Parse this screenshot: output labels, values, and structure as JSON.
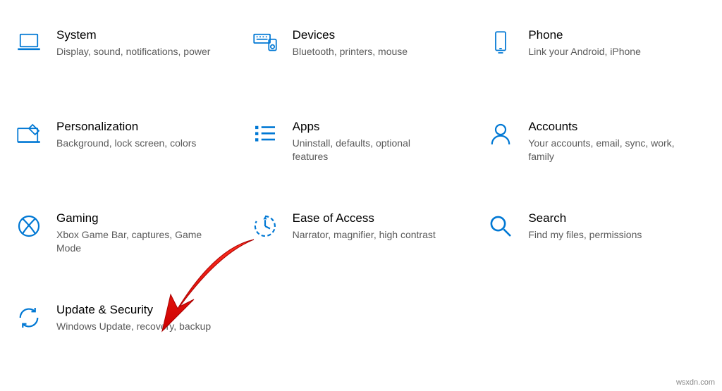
{
  "accent_color": "#0078d4",
  "tiles": [
    {
      "id": "system",
      "title": "System",
      "desc": "Display, sound, notifications, power"
    },
    {
      "id": "devices",
      "title": "Devices",
      "desc": "Bluetooth, printers, mouse"
    },
    {
      "id": "phone",
      "title": "Phone",
      "desc": "Link your Android, iPhone"
    },
    {
      "id": "personalization",
      "title": "Personalization",
      "desc": "Background, lock screen, colors"
    },
    {
      "id": "apps",
      "title": "Apps",
      "desc": "Uninstall, defaults, optional features"
    },
    {
      "id": "accounts",
      "title": "Accounts",
      "desc": "Your accounts, email, sync, work, family"
    },
    {
      "id": "gaming",
      "title": "Gaming",
      "desc": "Xbox Game Bar, captures, Game Mode"
    },
    {
      "id": "ease-of-access",
      "title": "Ease of Access",
      "desc": "Narrator, magnifier, high contrast"
    },
    {
      "id": "search",
      "title": "Search",
      "desc": "Find my files, permissions"
    },
    {
      "id": "update-security",
      "title": "Update & Security",
      "desc": "Windows Update, recovery, backup"
    }
  ],
  "watermark": "wsxdn.com"
}
